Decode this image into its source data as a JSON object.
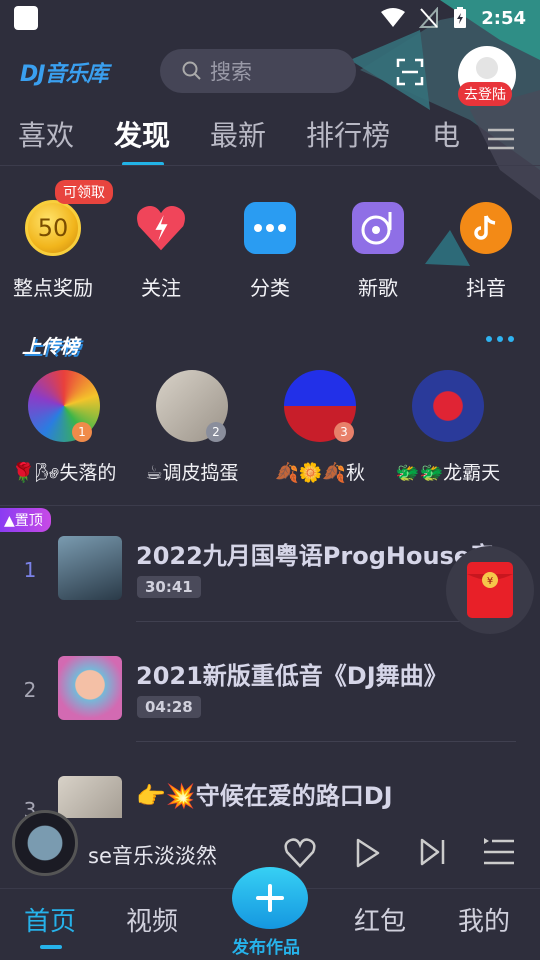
{
  "status": {
    "time": "2:54"
  },
  "header": {
    "logo": "DJ音乐库",
    "search_placeholder": "搜索",
    "login_label": "去登陆"
  },
  "tabs": [
    "喜欢",
    "发现",
    "最新",
    "排行榜",
    "电"
  ],
  "quick": [
    {
      "label": "整点奖励",
      "coin_value": "50",
      "badge": "可领取",
      "icon": "coin-icon"
    },
    {
      "label": "关注",
      "icon": "heart-bolt-icon"
    },
    {
      "label": "分类",
      "icon": "dots-icon"
    },
    {
      "label": "新歌",
      "icon": "vinyl-icon"
    },
    {
      "label": "抖音",
      "icon": "tiktok-icon"
    }
  ],
  "upload_section": {
    "title": "上传榜"
  },
  "uploaders": [
    {
      "name": "🌹🌬失落的",
      "rank": "1"
    },
    {
      "name": "☕调皮捣蛋",
      "rank": "2"
    },
    {
      "name": "🍂🌼🍂秋",
      "rank": "3"
    },
    {
      "name": "🐲🐲龙霸天",
      "rank": ""
    }
  ],
  "pin_label": "置顶",
  "songs": [
    {
      "rank": "1",
      "title": "2022九月国粤语ProgHouse音…",
      "duration": "30:41"
    },
    {
      "rank": "2",
      "title": "2021新版重低音《DJ舞曲》",
      "duration": "04:28"
    },
    {
      "rank": "3",
      "title": "👉💥守候在爱的路口DJ",
      "duration": ""
    }
  ],
  "player": {
    "title": "se音乐淡淡然"
  },
  "bottom_nav": {
    "home": "首页",
    "video": "视频",
    "publish": "发布作品",
    "redpacket": "红包",
    "mine": "我的"
  },
  "colors": {
    "accent": "#26b2ea",
    "background": "#2e2e3c",
    "red": "#e8343a"
  }
}
